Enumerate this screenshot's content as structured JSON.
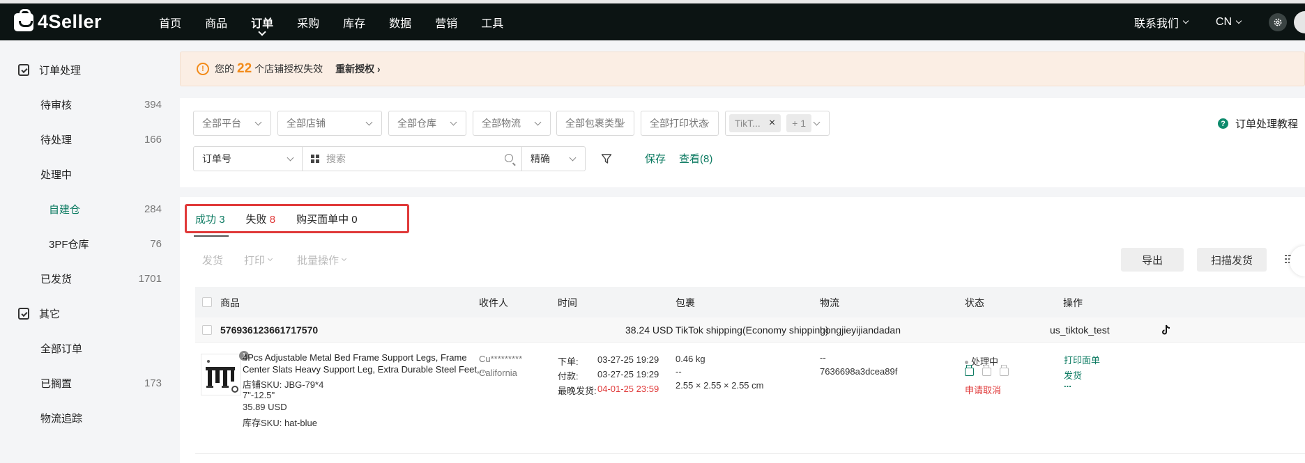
{
  "app": {
    "logo_text": "4Seller"
  },
  "nav": {
    "items": [
      "首页",
      "商品",
      "订单",
      "采购",
      "库存",
      "数据",
      "营销",
      "工具"
    ],
    "active_index": 2
  },
  "top_right": {
    "contact": "联系我们",
    "language": "CN"
  },
  "sidebar": {
    "group1": "订单处理",
    "items": [
      {
        "label": "待审核",
        "count": "394"
      },
      {
        "label": "待处理",
        "count": "166"
      },
      {
        "label": "处理中",
        "count": ""
      },
      {
        "label": "自建仓",
        "count": "284"
      },
      {
        "label": "3PF仓库",
        "count": "76"
      },
      {
        "label": "已发货",
        "count": "1701"
      }
    ],
    "group2": "其它",
    "items2": [
      {
        "label": "全部订单",
        "count": ""
      },
      {
        "label": "已搁置",
        "count": "173"
      },
      {
        "label": "物流追踪",
        "count": ""
      }
    ]
  },
  "banner": {
    "prefix": "您的",
    "count": "22",
    "suffix": "个店铺授权失效",
    "action": "重新授权"
  },
  "filters": {
    "platform": "全部平台",
    "store": "全部店铺",
    "warehouse": "全部仓库",
    "logistics": "全部物流",
    "package_type": "全部包裹类型",
    "print_status": "全部打印状态",
    "tag_chip": "TikT...",
    "tag_more": "+ 1",
    "tutorial": "订单处理教程",
    "order_field": "订单号",
    "search_placeholder": "搜索",
    "match_mode": "精确",
    "save": "保存",
    "view": "查看(8)"
  },
  "tabs": {
    "success_label": "成功",
    "success_count": "3",
    "fail_label": "失败",
    "fail_count": "8",
    "buying_label": "购买面单中",
    "buying_count": "0"
  },
  "actions": {
    "ship": "发货",
    "print": "打印",
    "batch": "批量操作",
    "export": "导出",
    "scan_ship": "扫描发货"
  },
  "table": {
    "headers": {
      "product": "商品",
      "recipient": "收件人",
      "time": "时间",
      "package": "包裹",
      "logistics": "物流",
      "status": "状态",
      "operation": "操作"
    },
    "order": {
      "id": "576936123661717570",
      "amount": "38.24 USD",
      "shipping": "TikTok shipping(Economy shipping)",
      "carrier": "hongjieyijiandadan",
      "store": "us_tiktok_test"
    },
    "item": {
      "qty": "1",
      "title_line1": "4Pcs Adjustable Metal Bed Frame Support Legs, Frame",
      "title_line2": "Center Slats Heavy Support Leg, Extra Durable Steel Feet,...",
      "store_sku": "店铺SKU: JBG-79*4",
      "variant": "7\"-12.5\"",
      "price": "35.89 USD",
      "stock_sku": "库存SKU: hat-blue",
      "recipient_name": "Cu*********",
      "recipient_state": "California",
      "order_time_label": "下单:",
      "order_time": "03-27-25 19:29",
      "paid_time_label": "付款:",
      "paid_time": "03-27-25 19:29",
      "latest_ship_label": "最晚发货:",
      "latest_ship": "04-01-25 23:59",
      "weight": "0.46 kg",
      "weight_dash": "--",
      "dimensions": "2.55 × 2.55 × 2.55 cm",
      "logistics_dash": "--",
      "tracking": "7636698a3dcea89f",
      "status": "处理中",
      "cancel_request": "申请取消",
      "op_print": "打印面单",
      "op_ship": "发货",
      "op_more": "..."
    }
  },
  "colors": {
    "brand_green": "#0d7b62",
    "warning_orange": "#f28b1a",
    "danger_red": "#e03a3a",
    "topbar": "#0c1413"
  }
}
